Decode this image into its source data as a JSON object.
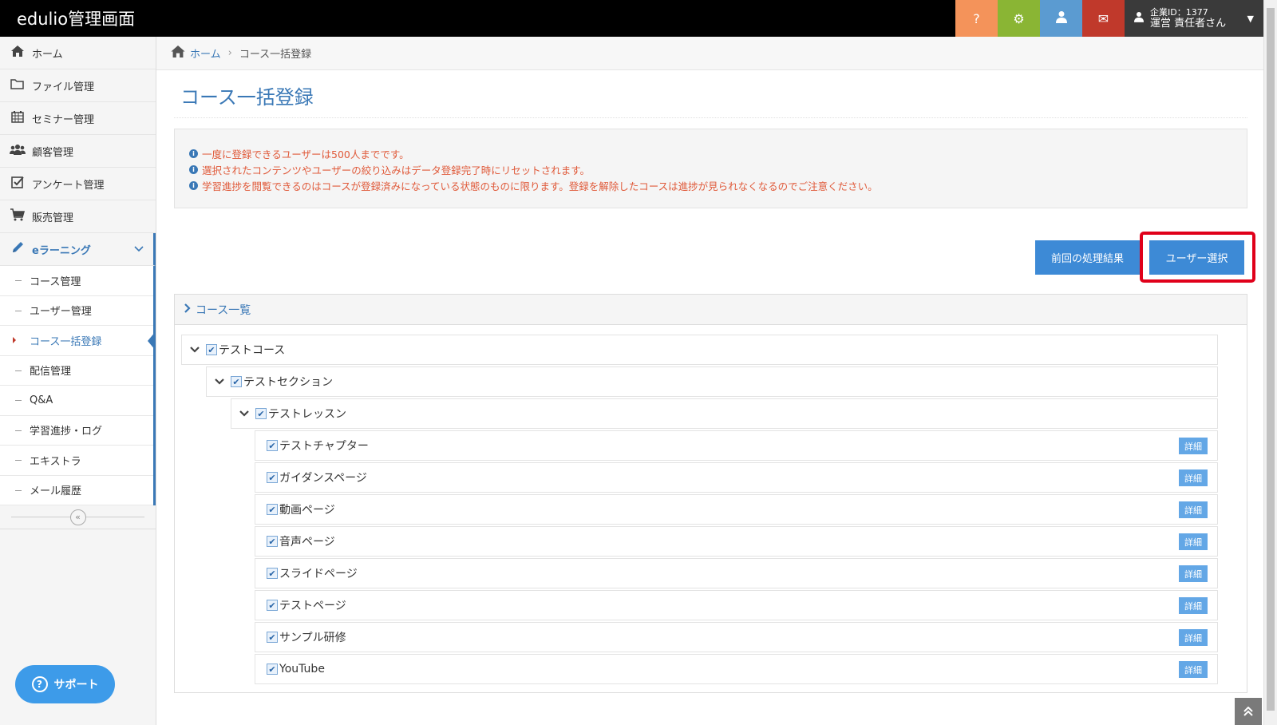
{
  "app": {
    "title": "edulio管理画面"
  },
  "header": {
    "help_icon": "?",
    "gear_icon": "⚙",
    "user_icon": "👤",
    "mail_icon": "✉",
    "account_id": "企業ID：1377",
    "account_name": "運営 責任者さん"
  },
  "sidebar": {
    "items": [
      {
        "label": "ホーム",
        "icon": "home-icon"
      },
      {
        "label": "ファイル管理",
        "icon": "folder-icon"
      },
      {
        "label": "セミナー管理",
        "icon": "calendar-icon"
      },
      {
        "label": "顧客管理",
        "icon": "users-icon"
      },
      {
        "label": "アンケート管理",
        "icon": "checkbox-icon"
      },
      {
        "label": "販売管理",
        "icon": "cart-icon"
      },
      {
        "label": "eラーニング",
        "icon": "pencil-icon"
      }
    ],
    "sub_items": [
      {
        "label": "コース管理"
      },
      {
        "label": "ユーザー管理"
      },
      {
        "label": "コース一括登録"
      },
      {
        "label": "配信管理"
      },
      {
        "label": "Q&A"
      },
      {
        "label": "学習進捗・ログ"
      },
      {
        "label": "エキストラ"
      },
      {
        "label": "メール履歴"
      }
    ],
    "support_label": "サポート"
  },
  "breadcrumb": {
    "home": "ホーム",
    "current": "コース一括登録"
  },
  "main": {
    "title": "コース一括登録",
    "notices": [
      "一度に登録できるユーザーは500人までです。",
      "選択されたコンテンツやユーザーの絞り込みはデータ登録完了時にリセットされます。",
      "学習進捗を閲覧できるのはコースが登録済みになっている状態のものに限ります。登録を解除したコースは進捗が見られなくなるのでご注意ください。"
    ],
    "prev_result_button": "前回の処理結果",
    "user_select_button": "ユーザー選択",
    "panel_title": "コース一覧",
    "tree": {
      "course": "テストコース",
      "section": "テストセクション",
      "lesson": "テストレッスン",
      "chapters": [
        {
          "label": "テストチャプター",
          "detail": "詳細"
        },
        {
          "label": "ガイダンスページ",
          "detail": "詳細"
        },
        {
          "label": "動画ページ",
          "detail": "詳細"
        },
        {
          "label": "音声ページ",
          "detail": "詳細"
        },
        {
          "label": "スライドページ",
          "detail": "詳細"
        },
        {
          "label": "テストページ",
          "detail": "詳細"
        },
        {
          "label": "サンプル研修",
          "detail": "詳細"
        },
        {
          "label": "YouTube",
          "detail": "詳細"
        }
      ]
    }
  },
  "colors": {
    "accent": "#3a78b6",
    "button": "#3d8ad6",
    "highlight": "#e0001a",
    "notice_text": "#e05a3a"
  }
}
